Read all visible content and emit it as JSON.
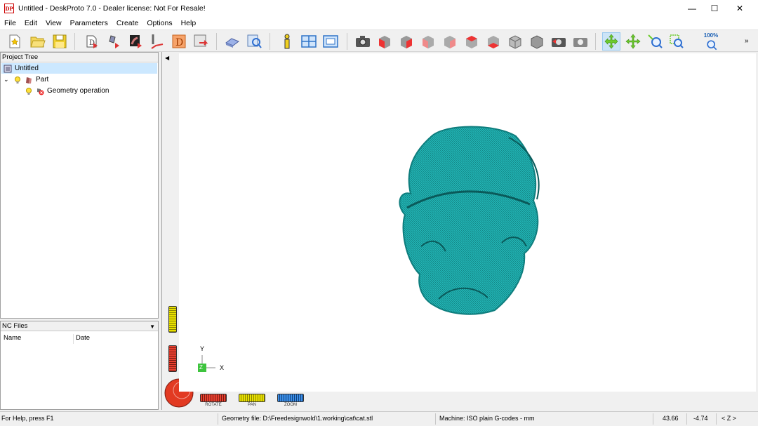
{
  "window": {
    "logo": "DP",
    "title": "Untitled - DeskProto 7.0 - Dealer license: Not For Resale!",
    "minimize": "—",
    "maximize": "☐",
    "close": "✕"
  },
  "menu": [
    "File",
    "Edit",
    "View",
    "Parameters",
    "Create",
    "Options",
    "Help"
  ],
  "toolbar": {
    "zoom_label": "100%",
    "overflow": "»",
    "icons": [
      "new-icon",
      "open-icon",
      "save-icon",
      "import-geometry-icon",
      "import-part-icon",
      "import-bitmap-icon",
      "toolpath-icon",
      "import-dxf-icon",
      "export-icon",
      "simulate-icon",
      "preview-icon",
      "info-icon",
      "four-views-icon",
      "single-view-icon",
      "camera-icon",
      "view-front-icon",
      "view-back-icon",
      "view-left-icon",
      "view-right-icon",
      "view-top-icon",
      "view-bottom-icon",
      "view-iso-icon",
      "view-iso2-icon",
      "rotate-camera-icon",
      "reset-camera-icon",
      "rotate-mode-icon",
      "pan-mode-icon",
      "zoom-mode-icon",
      "zoom-window-icon",
      "zoom-all-icon"
    ]
  },
  "project_tree": {
    "header": "Project Tree",
    "root": "Untitled",
    "part": "Part",
    "operation": "Geometry operation"
  },
  "nc_files": {
    "header": "NC Files",
    "col_name": "Name",
    "col_date": "Date"
  },
  "viewport": {
    "axis_y": "Y",
    "axis_z": "Z",
    "axis_x": "X",
    "dial_rotate": "ROTATE",
    "dial_pan": "PAN",
    "dial_zoom": "ZOOM",
    "model_color": "#22b5b5"
  },
  "status": {
    "help": "For Help, press F1",
    "geometry": "Geometry file: D:\\Freedesignwold\\1.working\\cat\\cat.stl",
    "machine": "Machine: ISO plain G-codes - mm",
    "coord_x": "43.66",
    "coord_y": "-4.74",
    "axis": "< Z >"
  }
}
